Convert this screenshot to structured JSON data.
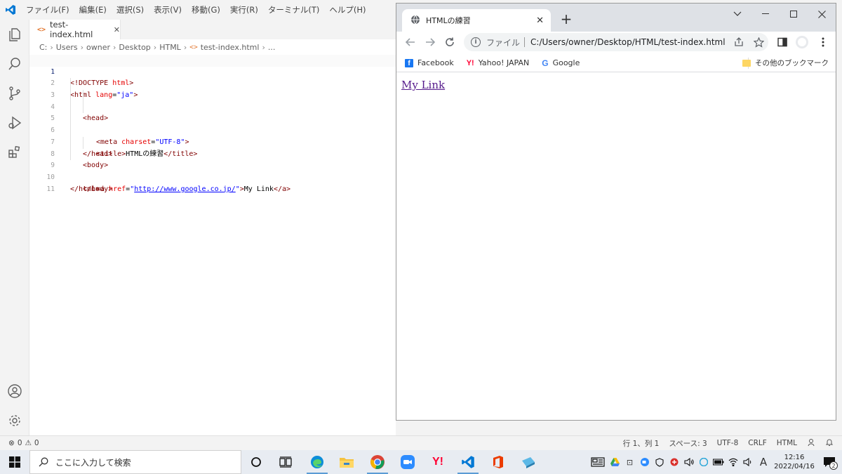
{
  "vscode": {
    "menu": [
      "ファイル(F)",
      "編集(E)",
      "選択(S)",
      "表示(V)",
      "移動(G)",
      "実行(R)",
      "ターミナル(T)",
      "ヘルプ(H)"
    ],
    "tab": {
      "icon": "<>",
      "label": "test-index.html",
      "close": "✕"
    },
    "breadcrumb": [
      "C:",
      "Users",
      "owner",
      "Desktop",
      "HTML",
      "test-index.html",
      "..."
    ],
    "line_numbers": [
      "1",
      "2",
      "3",
      "4",
      "5",
      "6",
      "7",
      "8",
      "9",
      "10",
      "11"
    ],
    "code": {
      "l1": {
        "t1": "<!DOCTYPE",
        "t2": " html",
        "t3": ">"
      },
      "l2": {
        "t1": "<html",
        "t2": " lang",
        "t3": "=",
        "t4": "\"ja\"",
        "t5": ">"
      },
      "l3": {
        "t1": "<head>"
      },
      "l4": {
        "t1": "<meta",
        "t2": " charset",
        "t3": "=",
        "t4": "\"UTF-8\"",
        "t5": ">"
      },
      "l5": {
        "t1": "<title>",
        "t2": "HTMLの練習",
        "t3": "</title>"
      },
      "l6": {
        "t1": "</head>"
      },
      "l7": {
        "t1": "<body>"
      },
      "l8": {
        "t1": "<a",
        "t2": " href",
        "t3": "=",
        "t4": "\"",
        "t5": "http://www.google.co.jp/",
        "t6": "\"",
        "t7": ">",
        "t8": "My Link",
        "t9": "</a>"
      },
      "l9": {
        "t1": "</body>"
      },
      "l10": {
        "t1": "</html>"
      }
    },
    "status": {
      "errors": "0",
      "warnings": "0",
      "position": "行 1、列 1",
      "spaces": "スペース: 3",
      "encoding": "UTF-8",
      "eol": "CRLF",
      "language": "HTML"
    }
  },
  "chrome": {
    "tab_title": "HTMLの練習",
    "tab_close": "✕",
    "new_tab": "+",
    "scheme_label": "ファイル",
    "url": "C:/Users/owner/Desktop/HTML/test-index.html",
    "bookmarks": [
      "Facebook",
      "Yahoo! JAPAN",
      "Google"
    ],
    "other_bookmarks": "その他のブックマーク",
    "page_link": "My Link"
  },
  "taskbar": {
    "search_placeholder": "ここに入力して検索",
    "ime": "A",
    "time": "12:16",
    "date": "2022/04/16",
    "notification_count": "2"
  },
  "colors": {
    "vscode_blue": "#0078d4",
    "visited_link": "#551a8b",
    "chrome_frame": "#dee1e6"
  }
}
